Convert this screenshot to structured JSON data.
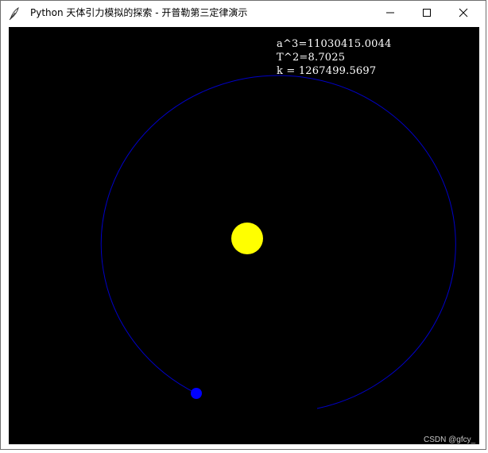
{
  "window": {
    "title": "Python 天体引力模拟的探索 - 开普勒第三定律演示",
    "app_icon": "feather-icon",
    "controls": {
      "minimize_icon": "minimize-icon",
      "maximize_icon": "maximize-icon",
      "close_icon": "close-icon"
    }
  },
  "simulation": {
    "background_color": "#000000",
    "sun_color": "#ffff00",
    "planet_color": "#0000ff",
    "orbit_color": "#0000c8",
    "readouts": {
      "a_cubed": "a^3=11030415.0044",
      "t_squared": "T^2=8.7025",
      "k_value": "k = 1267499.5697"
    }
  },
  "watermark": "CSDN @gfcy_"
}
